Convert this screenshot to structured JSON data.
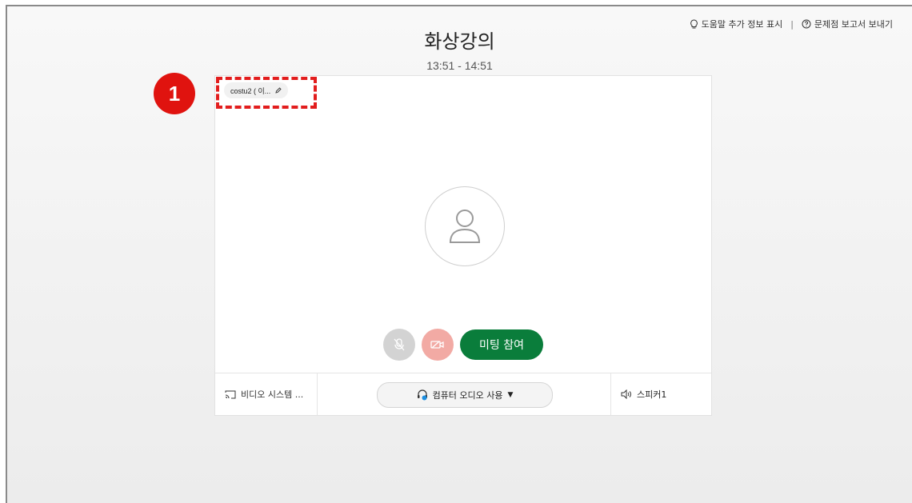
{
  "header": {
    "help_link": "도움말 추가 정보 표시",
    "separator": "|",
    "report_link": "문제점 보고서 보내기"
  },
  "meeting": {
    "title": "화상강의",
    "time": "13:51 - 14:51"
  },
  "user": {
    "display_name": "costu2 ( 이..."
  },
  "annotation": {
    "step_number": "1",
    "color": "#e0130f"
  },
  "controls": {
    "join_label": "미팅 참여",
    "join_color": "#0a7d3b"
  },
  "bottom_bar": {
    "video_system_label": "비디오 시스템 ...",
    "audio_label": "컴퓨터 오디오 사용",
    "speaker_label": "스피커1"
  },
  "icons": {
    "help": "lightbulb-icon",
    "report": "question-circle-icon",
    "edit": "pencil-icon",
    "avatar": "person-icon",
    "mute": "mic-off-icon",
    "video": "video-off-icon",
    "cast": "cast-icon",
    "headset": "headset-icon",
    "speaker": "speaker-icon",
    "caret": "caret-down-icon"
  }
}
